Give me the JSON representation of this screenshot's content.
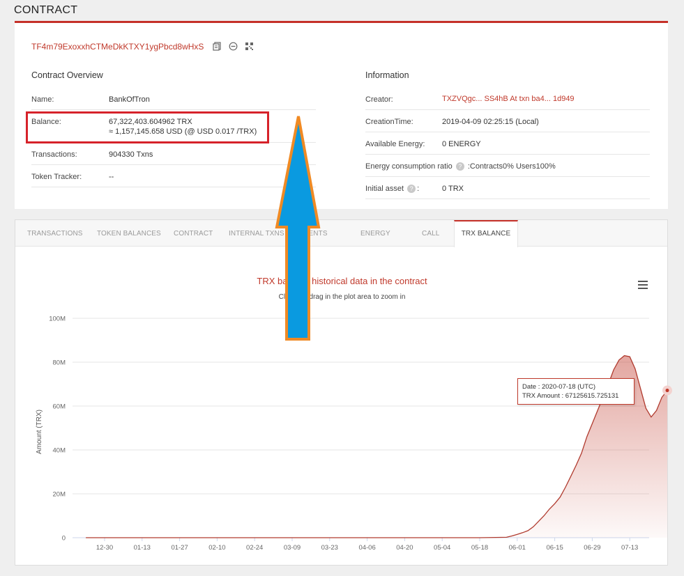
{
  "page_title": "CONTRACT",
  "address": "TF4m79ExoxxhCTMeDkKTXY1ygPbcd8wHxS",
  "overview": {
    "title": "Contract Overview",
    "name_label": "Name:",
    "name_value": "BankOfTron",
    "balance_label": "Balance:",
    "balance_trx": "67,322,403.604962 TRX",
    "balance_usd": "≈ 1,157,145.658 USD (@ USD 0.017 /TRX)",
    "transactions_label": "Transactions:",
    "transactions_value": "904330  Txns",
    "token_tracker_label": "Token Tracker:",
    "token_tracker_value": "--"
  },
  "information": {
    "title": "Information",
    "creator_label": "Creator:",
    "creator_value": "TXZVQgc... SS4hB At txn ba4... 1d949",
    "creation_time_label": "CreationTime:",
    "creation_time_value": "2019-04-09 02:25:15 (Local)",
    "energy_label": "Available Energy:",
    "energy_value": "0  ENERGY",
    "ratio_label": "Energy consumption ratio",
    "ratio_value": ":Contracts0%  Users100%",
    "initial_asset_label": "Initial asset",
    "initial_asset_value": "0 TRX"
  },
  "tabs": [
    {
      "label": "TRANSACTIONS"
    },
    {
      "label": "TOKEN BALANCES"
    },
    {
      "label": "CONTRACT"
    },
    {
      "label": "INTERNAL TXNS"
    },
    {
      "label": "EVENTS"
    },
    {
      "label": "ENERGY"
    },
    {
      "label": "CALL"
    },
    {
      "label": "TRX BALANCE",
      "active": true
    }
  ],
  "colors": {
    "accent": "#c53028",
    "link": "#c0392b",
    "highlight_box": "#d6222a",
    "arrow_fill": "#0a9ae0",
    "arrow_stroke": "#f08a24"
  },
  "icons": [
    "copy-icon",
    "minus-circle-icon",
    "qr-code-icon",
    "hamburger-menu-icon",
    "up-arrow-annotation"
  ],
  "chart_data": {
    "type": "area",
    "title": "TRX balance historical data in the contract",
    "subtitle": "Click and drag in the plot area to zoom in",
    "ylabel": "Amount (TRX)",
    "xlabel": "",
    "ylim": [
      0,
      100000000
    ],
    "y_ticks": [
      "0",
      "20M",
      "40M",
      "60M",
      "80M",
      "100M"
    ],
    "x_ticks": [
      "12-30",
      "01-13",
      "01-27",
      "02-10",
      "02-24",
      "03-09",
      "03-23",
      "04-06",
      "04-20",
      "05-04",
      "05-18",
      "06-01",
      "06-15",
      "06-29",
      "07-13"
    ],
    "series": [
      {
        "values": [
          [
            -7,
            0
          ],
          [
            0,
            0
          ],
          [
            20,
            0
          ],
          [
            40,
            0
          ],
          [
            60,
            0
          ],
          [
            80,
            0
          ],
          [
            100,
            0
          ],
          [
            120,
            0
          ],
          [
            140,
            0
          ],
          [
            150,
            200000
          ],
          [
            152,
            800000
          ],
          [
            154,
            1500000
          ],
          [
            156,
            2300000
          ],
          [
            158,
            3200000
          ],
          [
            160,
            5000000
          ],
          [
            162,
            7500000
          ],
          [
            164,
            10000000
          ],
          [
            166,
            13000000
          ],
          [
            168,
            15500000
          ],
          [
            170,
            18500000
          ],
          [
            172,
            23000000
          ],
          [
            174,
            28000000
          ],
          [
            176,
            33000000
          ],
          [
            178,
            38500000
          ],
          [
            180,
            46000000
          ],
          [
            182,
            52000000
          ],
          [
            184,
            58000000
          ],
          [
            186,
            64000000
          ],
          [
            188,
            70000000
          ],
          [
            190,
            76500000
          ],
          [
            192,
            81000000
          ],
          [
            194,
            83000000
          ],
          [
            196,
            82500000
          ],
          [
            198,
            77000000
          ],
          [
            200,
            68000000
          ],
          [
            202,
            59000000
          ],
          [
            204,
            55000000
          ],
          [
            206,
            58000000
          ],
          [
            208,
            64000000
          ],
          [
            210,
            67125615.725131
          ]
        ]
      }
    ],
    "tooltip": {
      "date": "Date : 2020-07-18 (UTC)",
      "amount": "TRX Amount : 67125615.725131"
    }
  }
}
